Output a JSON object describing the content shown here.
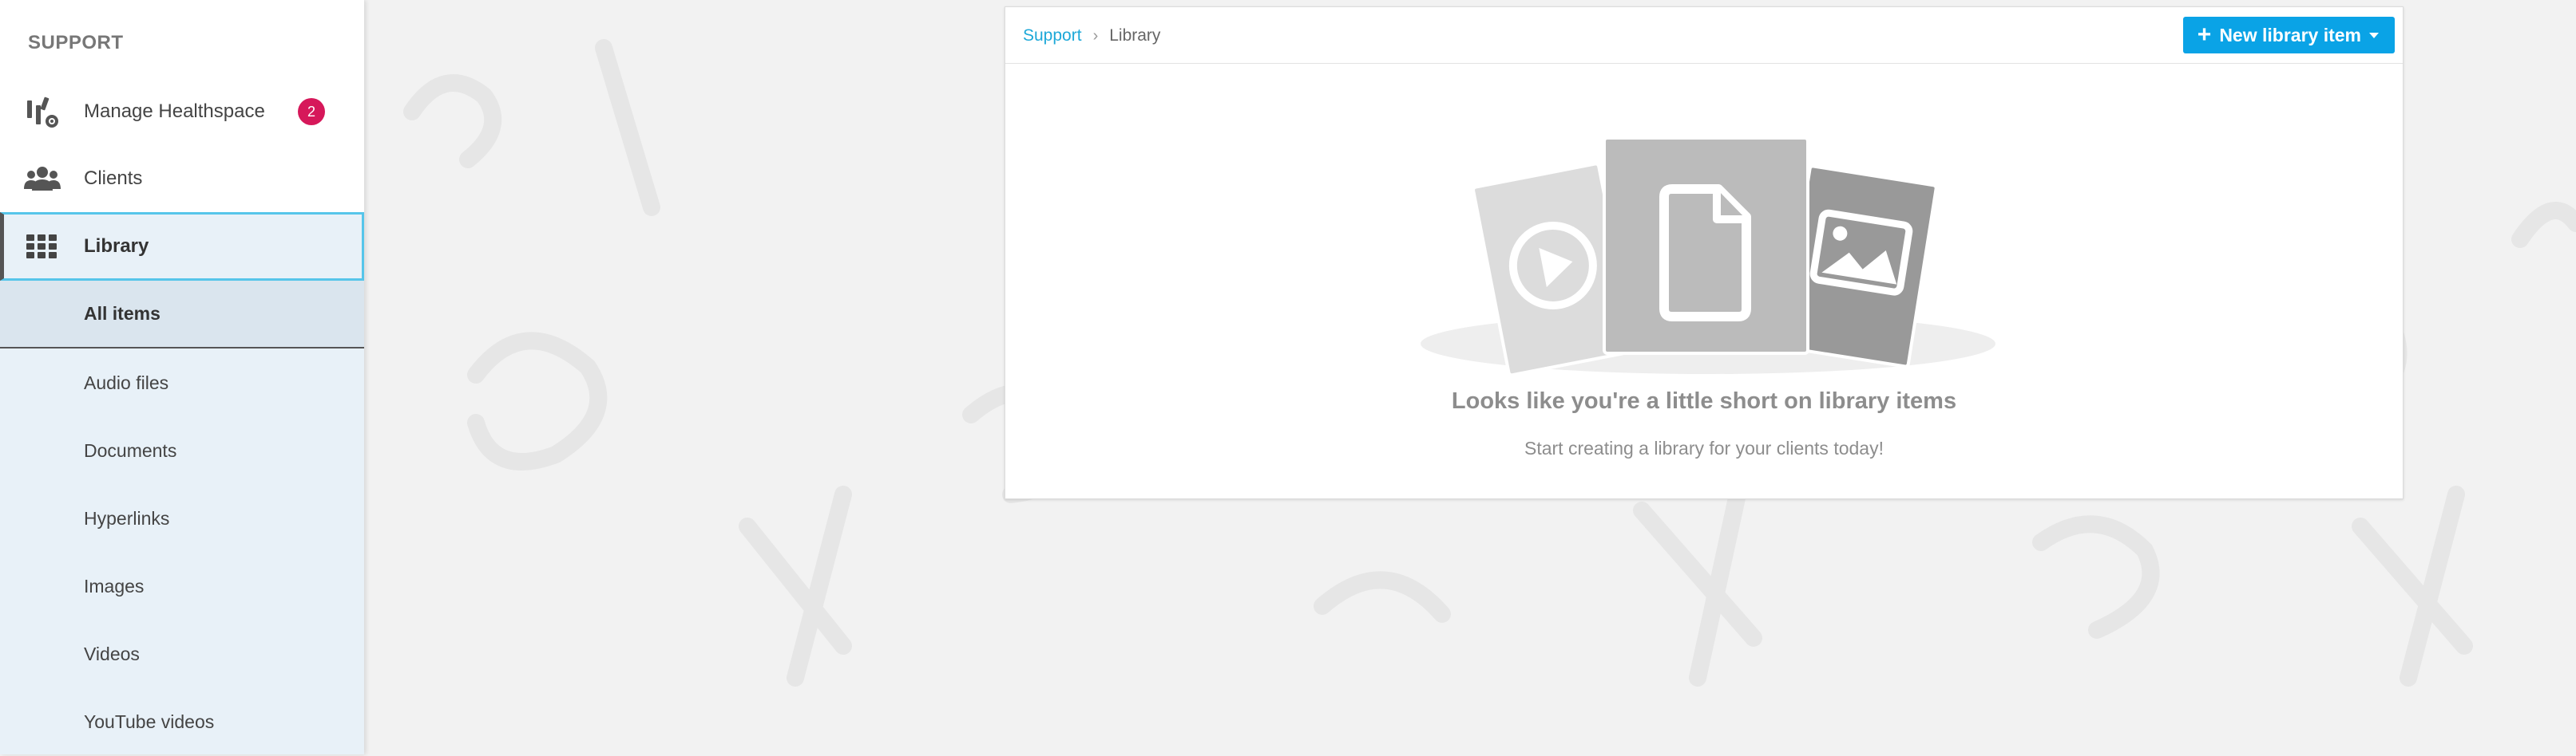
{
  "sidebar": {
    "section_title": "SUPPORT",
    "items": [
      {
        "label": "Manage Healthspace",
        "icon": "manage-healthspace-icon",
        "badge": "2"
      },
      {
        "label": "Clients",
        "icon": "clients-icon"
      },
      {
        "label": "Library",
        "icon": "grid-icon",
        "active": true
      }
    ],
    "submenu": [
      {
        "label": "All items",
        "selected": true
      },
      {
        "label": "Audio files"
      },
      {
        "label": "Documents"
      },
      {
        "label": "Hyperlinks"
      },
      {
        "label": "Images"
      },
      {
        "label": "Videos"
      },
      {
        "label": "YouTube videos"
      }
    ]
  },
  "breadcrumb": {
    "root": "Support",
    "separator": "›",
    "current": "Library"
  },
  "toolbar": {
    "new_button_label": "New library item"
  },
  "empty_state": {
    "title": "Looks like you're a little short on library items",
    "subtitle": "Start creating a library for your clients today!"
  },
  "colors": {
    "accent": "#0aa3e6",
    "link": "#1da8d8",
    "badge": "#d6185a",
    "active_border": "#56c5ea"
  }
}
